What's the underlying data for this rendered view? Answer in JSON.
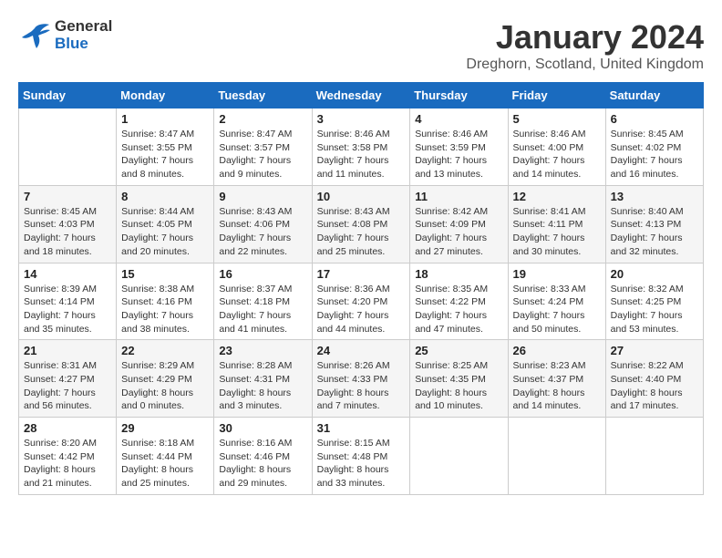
{
  "header": {
    "logo_general": "General",
    "logo_blue": "Blue",
    "month_title": "January 2024",
    "location": "Dreghorn, Scotland, United Kingdom"
  },
  "calendar": {
    "days_of_week": [
      "Sunday",
      "Monday",
      "Tuesday",
      "Wednesday",
      "Thursday",
      "Friday",
      "Saturday"
    ],
    "weeks": [
      [
        {
          "date": "",
          "sunrise": "",
          "sunset": "",
          "daylight": ""
        },
        {
          "date": "1",
          "sunrise": "Sunrise: 8:47 AM",
          "sunset": "Sunset: 3:55 PM",
          "daylight": "Daylight: 7 hours and 8 minutes."
        },
        {
          "date": "2",
          "sunrise": "Sunrise: 8:47 AM",
          "sunset": "Sunset: 3:57 PM",
          "daylight": "Daylight: 7 hours and 9 minutes."
        },
        {
          "date": "3",
          "sunrise": "Sunrise: 8:46 AM",
          "sunset": "Sunset: 3:58 PM",
          "daylight": "Daylight: 7 hours and 11 minutes."
        },
        {
          "date": "4",
          "sunrise": "Sunrise: 8:46 AM",
          "sunset": "Sunset: 3:59 PM",
          "daylight": "Daylight: 7 hours and 13 minutes."
        },
        {
          "date": "5",
          "sunrise": "Sunrise: 8:46 AM",
          "sunset": "Sunset: 4:00 PM",
          "daylight": "Daylight: 7 hours and 14 minutes."
        },
        {
          "date": "6",
          "sunrise": "Sunrise: 8:45 AM",
          "sunset": "Sunset: 4:02 PM",
          "daylight": "Daylight: 7 hours and 16 minutes."
        }
      ],
      [
        {
          "date": "7",
          "sunrise": "Sunrise: 8:45 AM",
          "sunset": "Sunset: 4:03 PM",
          "daylight": "Daylight: 7 hours and 18 minutes."
        },
        {
          "date": "8",
          "sunrise": "Sunrise: 8:44 AM",
          "sunset": "Sunset: 4:05 PM",
          "daylight": "Daylight: 7 hours and 20 minutes."
        },
        {
          "date": "9",
          "sunrise": "Sunrise: 8:43 AM",
          "sunset": "Sunset: 4:06 PM",
          "daylight": "Daylight: 7 hours and 22 minutes."
        },
        {
          "date": "10",
          "sunrise": "Sunrise: 8:43 AM",
          "sunset": "Sunset: 4:08 PM",
          "daylight": "Daylight: 7 hours and 25 minutes."
        },
        {
          "date": "11",
          "sunrise": "Sunrise: 8:42 AM",
          "sunset": "Sunset: 4:09 PM",
          "daylight": "Daylight: 7 hours and 27 minutes."
        },
        {
          "date": "12",
          "sunrise": "Sunrise: 8:41 AM",
          "sunset": "Sunset: 4:11 PM",
          "daylight": "Daylight: 7 hours and 30 minutes."
        },
        {
          "date": "13",
          "sunrise": "Sunrise: 8:40 AM",
          "sunset": "Sunset: 4:13 PM",
          "daylight": "Daylight: 7 hours and 32 minutes."
        }
      ],
      [
        {
          "date": "14",
          "sunrise": "Sunrise: 8:39 AM",
          "sunset": "Sunset: 4:14 PM",
          "daylight": "Daylight: 7 hours and 35 minutes."
        },
        {
          "date": "15",
          "sunrise": "Sunrise: 8:38 AM",
          "sunset": "Sunset: 4:16 PM",
          "daylight": "Daylight: 7 hours and 38 minutes."
        },
        {
          "date": "16",
          "sunrise": "Sunrise: 8:37 AM",
          "sunset": "Sunset: 4:18 PM",
          "daylight": "Daylight: 7 hours and 41 minutes."
        },
        {
          "date": "17",
          "sunrise": "Sunrise: 8:36 AM",
          "sunset": "Sunset: 4:20 PM",
          "daylight": "Daylight: 7 hours and 44 minutes."
        },
        {
          "date": "18",
          "sunrise": "Sunrise: 8:35 AM",
          "sunset": "Sunset: 4:22 PM",
          "daylight": "Daylight: 7 hours and 47 minutes."
        },
        {
          "date": "19",
          "sunrise": "Sunrise: 8:33 AM",
          "sunset": "Sunset: 4:24 PM",
          "daylight": "Daylight: 7 hours and 50 minutes."
        },
        {
          "date": "20",
          "sunrise": "Sunrise: 8:32 AM",
          "sunset": "Sunset: 4:25 PM",
          "daylight": "Daylight: 7 hours and 53 minutes."
        }
      ],
      [
        {
          "date": "21",
          "sunrise": "Sunrise: 8:31 AM",
          "sunset": "Sunset: 4:27 PM",
          "daylight": "Daylight: 7 hours and 56 minutes."
        },
        {
          "date": "22",
          "sunrise": "Sunrise: 8:29 AM",
          "sunset": "Sunset: 4:29 PM",
          "daylight": "Daylight: 8 hours and 0 minutes."
        },
        {
          "date": "23",
          "sunrise": "Sunrise: 8:28 AM",
          "sunset": "Sunset: 4:31 PM",
          "daylight": "Daylight: 8 hours and 3 minutes."
        },
        {
          "date": "24",
          "sunrise": "Sunrise: 8:26 AM",
          "sunset": "Sunset: 4:33 PM",
          "daylight": "Daylight: 8 hours and 7 minutes."
        },
        {
          "date": "25",
          "sunrise": "Sunrise: 8:25 AM",
          "sunset": "Sunset: 4:35 PM",
          "daylight": "Daylight: 8 hours and 10 minutes."
        },
        {
          "date": "26",
          "sunrise": "Sunrise: 8:23 AM",
          "sunset": "Sunset: 4:37 PM",
          "daylight": "Daylight: 8 hours and 14 minutes."
        },
        {
          "date": "27",
          "sunrise": "Sunrise: 8:22 AM",
          "sunset": "Sunset: 4:40 PM",
          "daylight": "Daylight: 8 hours and 17 minutes."
        }
      ],
      [
        {
          "date": "28",
          "sunrise": "Sunrise: 8:20 AM",
          "sunset": "Sunset: 4:42 PM",
          "daylight": "Daylight: 8 hours and 21 minutes."
        },
        {
          "date": "29",
          "sunrise": "Sunrise: 8:18 AM",
          "sunset": "Sunset: 4:44 PM",
          "daylight": "Daylight: 8 hours and 25 minutes."
        },
        {
          "date": "30",
          "sunrise": "Sunrise: 8:16 AM",
          "sunset": "Sunset: 4:46 PM",
          "daylight": "Daylight: 8 hours and 29 minutes."
        },
        {
          "date": "31",
          "sunrise": "Sunrise: 8:15 AM",
          "sunset": "Sunset: 4:48 PM",
          "daylight": "Daylight: 8 hours and 33 minutes."
        },
        {
          "date": "",
          "sunrise": "",
          "sunset": "",
          "daylight": ""
        },
        {
          "date": "",
          "sunrise": "",
          "sunset": "",
          "daylight": ""
        },
        {
          "date": "",
          "sunrise": "",
          "sunset": "",
          "daylight": ""
        }
      ]
    ]
  }
}
